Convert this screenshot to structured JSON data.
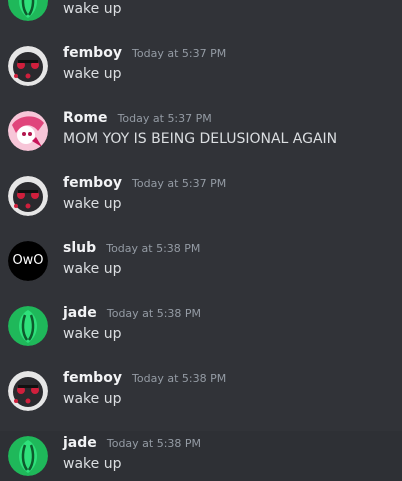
{
  "messages": [
    {
      "username": "",
      "timestamp": "",
      "text": "wake up",
      "avatar": "green-leaf-avatar"
    },
    {
      "username": "femboy",
      "timestamp": "Today at 5:37 PM",
      "text": "wake up",
      "avatar": "dark-skull-avatar"
    },
    {
      "username": "Rome",
      "timestamp": "Today at 5:37 PM",
      "text": "MOM YOY IS BEING DELUSIONAL AGAIN",
      "avatar": "pink-character-avatar"
    },
    {
      "username": "femboy",
      "timestamp": "Today at 5:37 PM",
      "text": "wake up",
      "avatar": "dark-skull-avatar"
    },
    {
      "username": "slub",
      "timestamp": "Today at 5:38 PM",
      "text": "wake up",
      "avatar": "owo-avatar",
      "avatar_text": "OwO"
    },
    {
      "username": "jade",
      "timestamp": "Today at 5:38 PM",
      "text": "wake up",
      "avatar": "green-leaf-avatar"
    },
    {
      "username": "femboy",
      "timestamp": "Today at 5:38 PM",
      "text": "wake up",
      "avatar": "dark-skull-avatar"
    },
    {
      "username": "jade",
      "timestamp": "Today at 5:38 PM",
      "text": "wake up",
      "avatar": "green-leaf-avatar"
    }
  ],
  "colors": {
    "background": "#313338",
    "hover_row": "#2e3035",
    "username": "#f2f3f5",
    "timestamp": "#949ba4",
    "text": "#dbdee1"
  }
}
